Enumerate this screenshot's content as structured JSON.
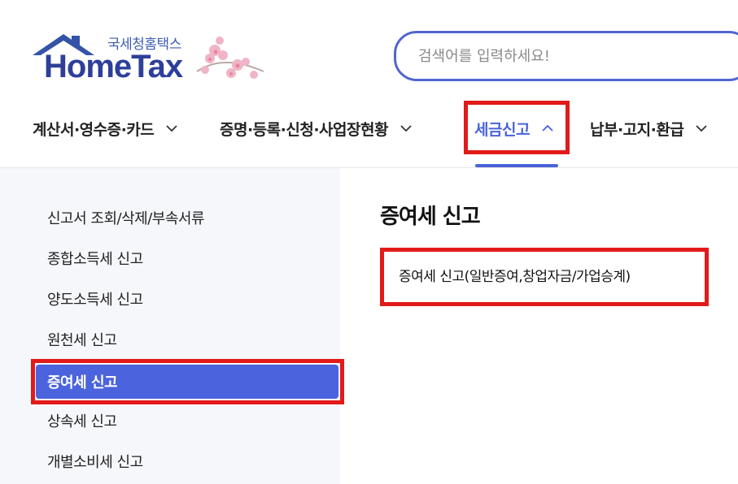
{
  "header": {
    "logo_sub": "국세청홈택스",
    "logo_main": "HomeTax",
    "search_placeholder": "검색어를 입력하세요!"
  },
  "nav": {
    "items": [
      {
        "label": "계산서·영수증·카드",
        "icon": "chevron-down-icon"
      },
      {
        "label": "증명·등록·신청·사업장현황",
        "icon": "chevron-down-icon"
      },
      {
        "label": "세금신고",
        "icon": "chevron-up-icon",
        "active": true
      },
      {
        "label": "납부·고지·환급",
        "icon": "chevron-down-icon"
      }
    ]
  },
  "sidebar": {
    "items": [
      {
        "label": "신고서 조회/삭제/부속서류"
      },
      {
        "label": "종합소득세 신고"
      },
      {
        "label": "양도소득세 신고"
      },
      {
        "label": "원천세 신고"
      },
      {
        "label": "증여세 신고",
        "active": true
      },
      {
        "label": "상속세 신고"
      },
      {
        "label": "개별소비세 신고"
      }
    ]
  },
  "main": {
    "title": "증여세 신고",
    "links": [
      {
        "label": "증여세 신고(일반증여,창업자금/가업승계)"
      }
    ]
  },
  "colors": {
    "accent": "#4b63dd",
    "highlight": "#e21a1a",
    "logo_blue": "#2e3f9a",
    "sidebar_bg": "#f6f7fb"
  }
}
